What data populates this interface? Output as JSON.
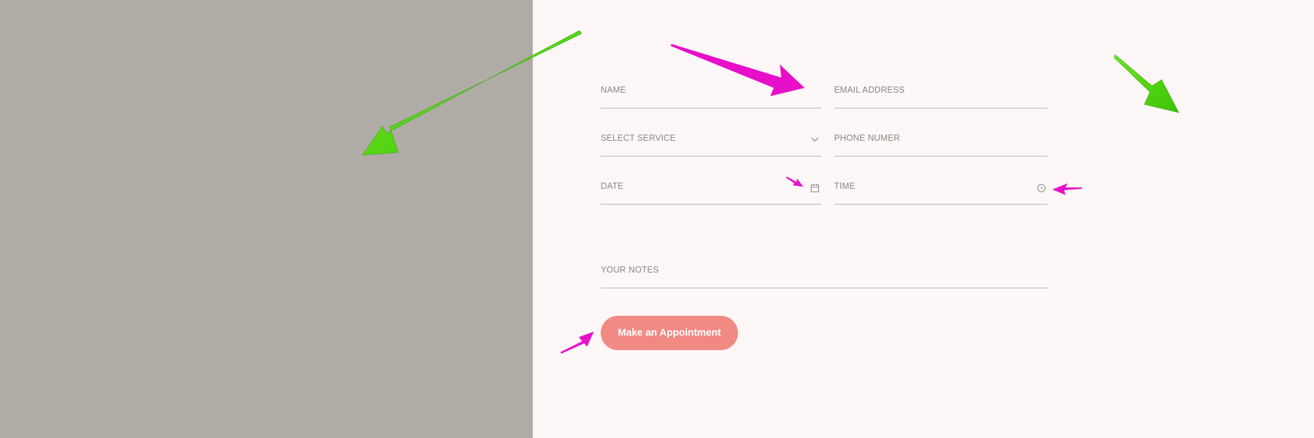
{
  "form": {
    "name_label": "NAME",
    "email_label": "EMAIL ADDRESS",
    "service_label": "SELECT SERVICE",
    "phone_label": "PHONE NUMER",
    "date_label": "DATE",
    "time_label": "TIME",
    "notes_label": "YOUR NOTES",
    "submit_label": "Make an Appointment"
  },
  "colors": {
    "left_panel": "#afaca5",
    "background": "#fdf7f7",
    "button": "#f28a84",
    "annotation_green": "#4cd40f",
    "annotation_magenta": "#e80fcb"
  },
  "icons": {
    "service": "chevron-down-icon",
    "date": "calendar-icon",
    "time": "clock-icon"
  }
}
